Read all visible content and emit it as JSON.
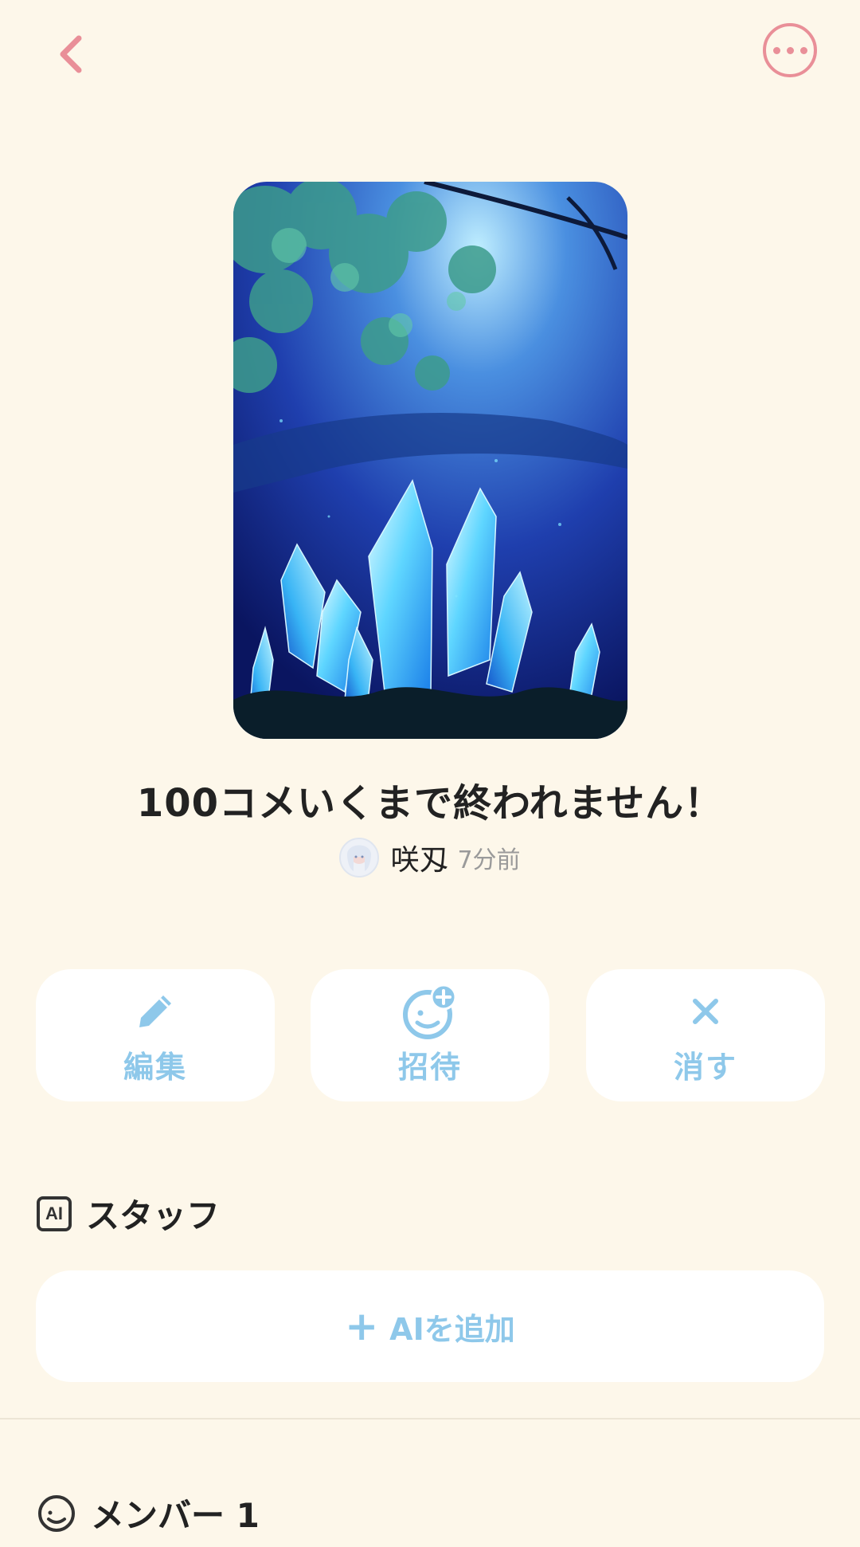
{
  "header": {
    "back_icon": "chevron-left-icon",
    "more_icon": "more-horizontal-icon"
  },
  "cover": {
    "image_desc_icon": "cover-image"
  },
  "room": {
    "title": "100コメいくまで終われません！"
  },
  "author": {
    "name": "咲刄",
    "time": "7分前"
  },
  "actions": [
    {
      "label": "編集",
      "icon": "pencil-icon"
    },
    {
      "label": "招待",
      "icon": "invite-smiley-plus-icon"
    },
    {
      "label": "消す",
      "icon": "close-icon"
    }
  ],
  "staff": {
    "heading": "スタッフ",
    "badge": "AI",
    "add_label": "AIを追加"
  },
  "members": {
    "heading": "メンバー 1"
  },
  "colors": {
    "accent_pink": "#e98f98",
    "accent_blue": "#8ec8ea",
    "background": "#fdf7ea"
  }
}
